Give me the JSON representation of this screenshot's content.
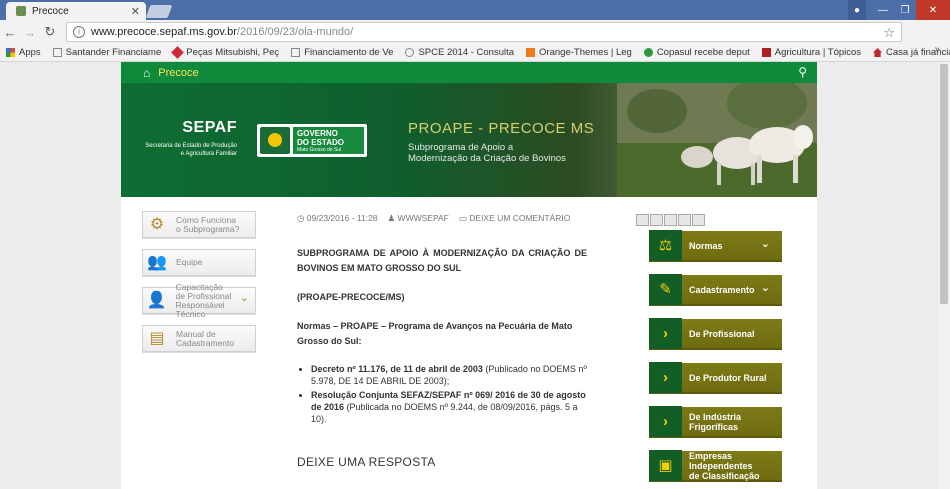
{
  "browser": {
    "tab_title": "Precoce",
    "url_host": "www.precoce.sepaf.ms.gov.br",
    "url_path": "/2016/09/23/ola-mundo/",
    "bookmarks": [
      {
        "label": "Apps",
        "color": "#d84a3a"
      },
      {
        "label": "Santander Financiame",
        "color": "#888888"
      },
      {
        "label": "Peças Mitsubishi, Peç",
        "color": "#d0263a"
      },
      {
        "label": "Financiamento de Ve",
        "color": "#888888"
      },
      {
        "label": "SPCE 2014 - Consulta",
        "color": "#888888"
      },
      {
        "label": "Orange-Themes | Leg",
        "color": "#f07a1a"
      },
      {
        "label": "Copasul recebe deput",
        "color": "#2b9a3a"
      },
      {
        "label": "Agricultura | Tópicos",
        "color": "#b01f24"
      },
      {
        "label": "Casa já financiada - V",
        "color": "#c12a2a"
      }
    ],
    "bookmarks_more": "»"
  },
  "site": {
    "nav_title": "Precoce",
    "banner": {
      "sepaf_title": "SEPAF",
      "sepaf_sub1": "Secretaria de Estado de Produção",
      "sepaf_sub2": "e Agricultura Familiar",
      "gov_line1": "GOVERNO",
      "gov_line2": "DO ESTADO",
      "gov_line3": "Mato Grosso do Sul",
      "proape_title": "PROAPE - PRECOCE MS",
      "proape_sub1": "Subprograma de Apoio a",
      "proape_sub2": "Modernização da Criação de Bovinos"
    },
    "left_menu": [
      {
        "line1": "Como Funciona",
        "line2": "o Subprograma?",
        "line3": ""
      },
      {
        "line1": "Equipe",
        "line2": "",
        "line3": ""
      },
      {
        "line1": "Capacitação",
        "line2": "de Profissional",
        "line3": "Responsável Técnico"
      },
      {
        "line1": "Manual de",
        "line2": "Cadastramento",
        "line3": ""
      }
    ],
    "post": {
      "date": "09/23/2016 - 11:28",
      "author": "WWWSEPAF",
      "comment_link": "DEIXE UM COMENTÁRIO",
      "heading": "SUBPROGRAMA DE APOIO À MODERNIZAÇÃO DA CRIAÇÃO DE BOVINOS EM MATO GROSSO DO SUL",
      "acronym": "(PROAPE-PRECOCE/MS)",
      "norms_intro": "Normas – PROAPE – Programa de Avanços na Pecuária de Mato Grosso do Sul:",
      "item1_bold": "Decreto nº 11.176, de 11 de abril de 2003",
      "item1_rest": " (Publicado no DOEMS nº 5.978, DE 14 DE ABRIL DE 2003);",
      "item2_bold": "Resolução Conjunta SEFAZ/SEPAF nº 069/ 2016 de 30 de agosto de 2016",
      "item2_rest": " (Publicada no DOEMS nº 9.244, de 08/09/2016, págs. 5 a 10).",
      "reply_heading": "DEIXE UMA RESPOSTA"
    },
    "right_menu": [
      {
        "line1": "Normas",
        "line2": "",
        "line3": "",
        "chevron": "down"
      },
      {
        "line1": "Cadastramento",
        "line2": "",
        "line3": "",
        "chevron": "down"
      },
      {
        "line1": "De Profissional",
        "line2": "",
        "line3": "",
        "chevron": "none"
      },
      {
        "line1": "De Produtor Rural",
        "line2": "",
        "line3": "",
        "chevron": "none"
      },
      {
        "line1": "De Indústria",
        "line2": "Frigoríficas",
        "line3": "",
        "chevron": "none"
      },
      {
        "line1": "Empresas",
        "line2": "Independentes",
        "line3": "de Classificação",
        "chevron": "none"
      }
    ]
  },
  "colors": {
    "nav_green": "#0f8a3a",
    "olive_button": "#7d7a17",
    "icon_green": "#135e26",
    "gold": "#f4d000"
  }
}
